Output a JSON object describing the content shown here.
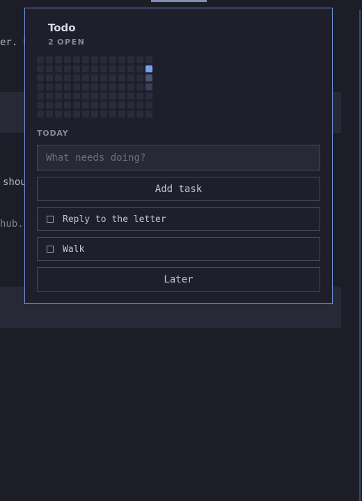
{
  "background": {
    "line1": "er. R",
    "line2": "shou",
    "line3": "hub.c"
  },
  "popup": {
    "title": "Todo",
    "open_count": "2",
    "open_label": "OPEN",
    "section_label": "TODAY",
    "input": {
      "value": "",
      "placeholder": "What needs doing?"
    },
    "add_button_label": "Add task",
    "tasks": [
      {
        "label": "Reply to the letter",
        "done": false
      },
      {
        "label": "Walk",
        "done": false
      }
    ],
    "later_button_label": "Later",
    "activity_grid": {
      "rows": 7,
      "columns": 13,
      "today": {
        "row": 1,
        "column": 12
      },
      "active_cells": [
        {
          "row": 2,
          "column": 12,
          "level": 1
        },
        {
          "row": 3,
          "column": 12,
          "level": 2
        }
      ]
    }
  },
  "colors": {
    "accent": "#6f93d8",
    "today_cell": "#7aa0ef",
    "background": "#1c1d27",
    "popup_background": "#1e1f2b"
  }
}
